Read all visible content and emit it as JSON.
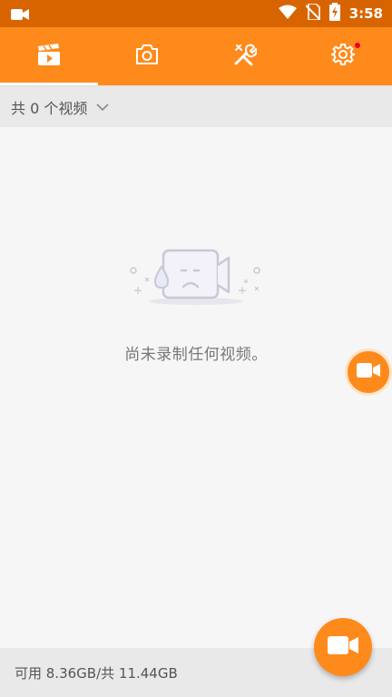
{
  "status_bar": {
    "time": "3:58",
    "left_icon": "video-camera-icon",
    "icons": [
      "wifi-icon",
      "no-sim-icon",
      "battery-charging-icon"
    ]
  },
  "tabs": [
    {
      "name": "videos",
      "icon": "clapperboard-icon",
      "active": true
    },
    {
      "name": "screenshots",
      "icon": "camera-icon",
      "active": false
    },
    {
      "name": "tools",
      "icon": "tools-icon",
      "active": false
    },
    {
      "name": "settings",
      "icon": "gear-icon",
      "active": false,
      "has_badge": true
    }
  ],
  "filter": {
    "label": "共 0 个视频"
  },
  "empty_state": {
    "message": "尚未录制任何视频。"
  },
  "footer": {
    "storage_text": "可用 8.36GB/共 11.44GB"
  },
  "colors": {
    "status_bar": "#d86400",
    "accent": "#ff8a1c",
    "badge": "#e8002a"
  }
}
